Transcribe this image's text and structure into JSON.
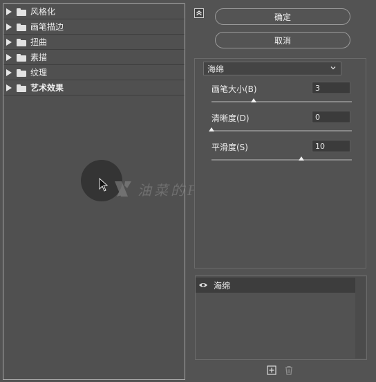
{
  "categories": [
    {
      "label": "风格化",
      "bold": false
    },
    {
      "label": "画笔描边",
      "bold": false
    },
    {
      "label": "扭曲",
      "bold": false
    },
    {
      "label": "素描",
      "bold": false
    },
    {
      "label": "纹理",
      "bold": false
    },
    {
      "label": "艺术效果",
      "bold": true
    }
  ],
  "buttons": {
    "ok": "确定",
    "cancel": "取消"
  },
  "filter": {
    "selected": "海绵"
  },
  "params": [
    {
      "label": "画笔大小(B)",
      "value": "3",
      "slider_fraction": 0.3
    },
    {
      "label": "清晰度(D)",
      "value": "0",
      "slider_fraction": 0.0
    },
    {
      "label": "平滑度(S)",
      "value": "10",
      "slider_fraction": 0.64
    }
  ],
  "layers": [
    {
      "name": "海绵",
      "visible": true
    }
  ],
  "watermark": {
    "text": "油菜的PS笔记"
  },
  "icons": {
    "collapse": "collapse-up-icon",
    "select_chevron": "chevron-down-icon",
    "eye": "eye-icon",
    "new_layer": "new-effect-layer-icon",
    "delete": "trash-icon",
    "cursor": "mouse-pointer-icon",
    "folder": "folder-icon",
    "expand": "expand-triangle-icon"
  },
  "colors": {
    "background": "#535353",
    "panel_border": "#a8a8a8",
    "selected_layer": "#3d3d3d"
  }
}
